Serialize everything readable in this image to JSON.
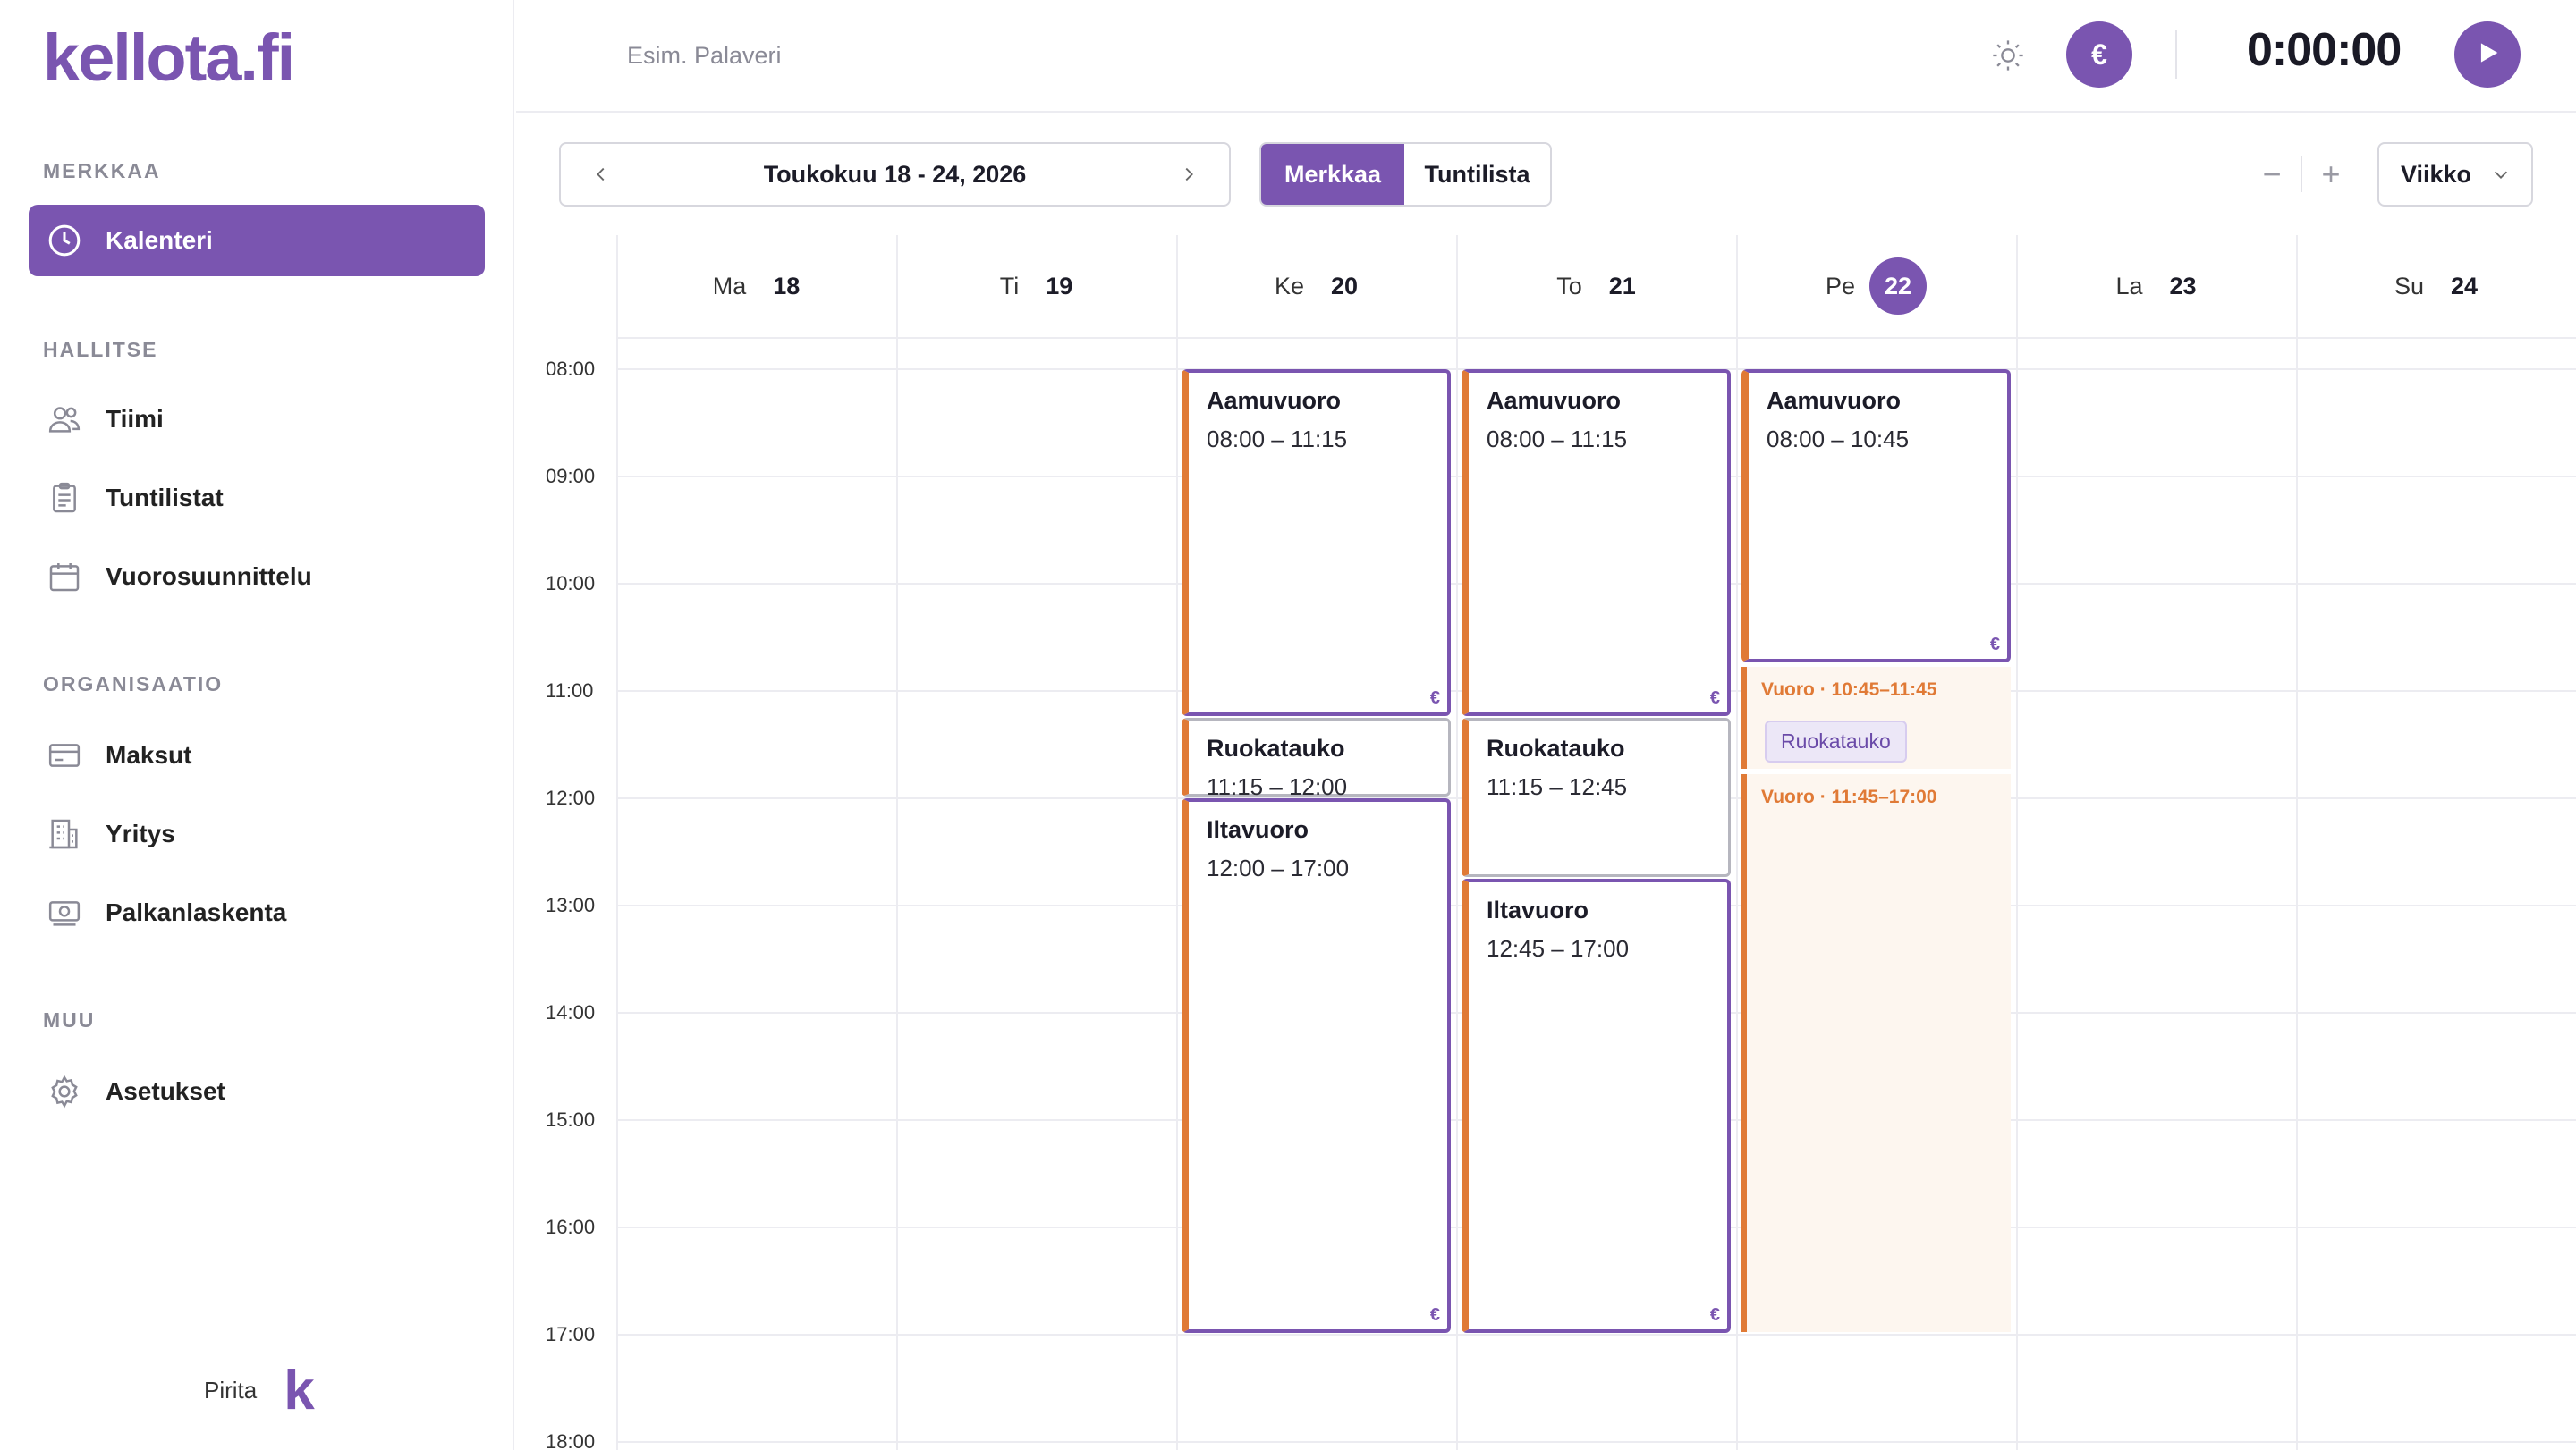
{
  "app": {
    "logo": "kellota.fi"
  },
  "sidebar": {
    "sections": [
      {
        "title": "MERKKAA"
      },
      {
        "title": "HALLITSE"
      },
      {
        "title": "ORGANISAATIO"
      },
      {
        "title": "MUU"
      }
    ],
    "items": [
      {
        "label": "Kalenteri",
        "icon": "clock-icon",
        "active": true
      },
      {
        "label": "Tiimi",
        "icon": "users-icon"
      },
      {
        "label": "Tuntilistat",
        "icon": "clipboard-icon"
      },
      {
        "label": "Vuorosuunnittelu",
        "icon": "calendar-icon"
      },
      {
        "label": "Maksut",
        "icon": "credit-card-icon"
      },
      {
        "label": "Yritys",
        "icon": "building-icon"
      },
      {
        "label": "Palkanlaskenta",
        "icon": "money-icon"
      },
      {
        "label": "Asetukset",
        "icon": "gear-icon"
      }
    ],
    "user": {
      "name": "Pirita",
      "mark": "k"
    }
  },
  "topbar": {
    "task_placeholder": "Esim. Palaveri",
    "euro_label": "€",
    "timer": "0:00:00"
  },
  "toolbar": {
    "date_range": "Toukokuu 18 - 24, 2026",
    "mode_merkkaa": "Merkkaa",
    "mode_tuntilista": "Tuntilista",
    "zoom_out": "−",
    "zoom_in": "+",
    "view": "Viikko"
  },
  "calendar": {
    "days": [
      {
        "name": "Ma",
        "date": "18"
      },
      {
        "name": "Ti",
        "date": "19"
      },
      {
        "name": "Ke",
        "date": "20"
      },
      {
        "name": "To",
        "date": "21"
      },
      {
        "name": "Pe",
        "date": "22",
        "today": true
      },
      {
        "name": "La",
        "date": "23"
      },
      {
        "name": "Su",
        "date": "24"
      }
    ],
    "hours": [
      "08:00",
      "09:00",
      "10:00",
      "11:00",
      "12:00",
      "13:00",
      "14:00",
      "15:00",
      "16:00",
      "17:00",
      "18:00"
    ],
    "events": [
      {
        "day": 2,
        "title": "Aamuvuoro",
        "time": "08:00 – 11:15",
        "start": 8.0,
        "end": 11.25,
        "kind": "shift",
        "euro": "€"
      },
      {
        "day": 2,
        "title": "Ruokatauko",
        "time": "11:15 – 12:00",
        "start": 11.25,
        "end": 12.0,
        "kind": "break"
      },
      {
        "day": 2,
        "title": "Iltavuoro",
        "time": "12:00 – 17:00",
        "start": 12.0,
        "end": 17.0,
        "kind": "shift",
        "euro": "€"
      },
      {
        "day": 3,
        "title": "Aamuvuoro",
        "time": "08:00 – 11:15",
        "start": 8.0,
        "end": 11.25,
        "kind": "shift",
        "euro": "€"
      },
      {
        "day": 3,
        "title": "Ruokatauko",
        "time": "11:15 – 12:45",
        "start": 11.25,
        "end": 12.75,
        "kind": "break"
      },
      {
        "day": 3,
        "title": "Iltavuoro",
        "time": "12:45 – 17:00",
        "start": 12.75,
        "end": 17.0,
        "kind": "shift",
        "euro": "€"
      },
      {
        "day": 4,
        "title": "Aamuvuoro",
        "time": "08:00 – 10:45",
        "start": 8.0,
        "end": 10.75,
        "kind": "shift",
        "euro": "€"
      }
    ],
    "pending": [
      {
        "day": 4,
        "label": "Vuoro · 10:45–11:45",
        "start": 10.75,
        "end": 11.75,
        "chip": "Ruokatauko"
      },
      {
        "day": 4,
        "label": "Vuoro · 11:45–17:00",
        "start": 11.75,
        "end": 17.0
      }
    ]
  },
  "colors": {
    "accent": "#7a55b0",
    "shift_stripe": "#e07a36",
    "pending_bg": "#fdf6ef"
  }
}
